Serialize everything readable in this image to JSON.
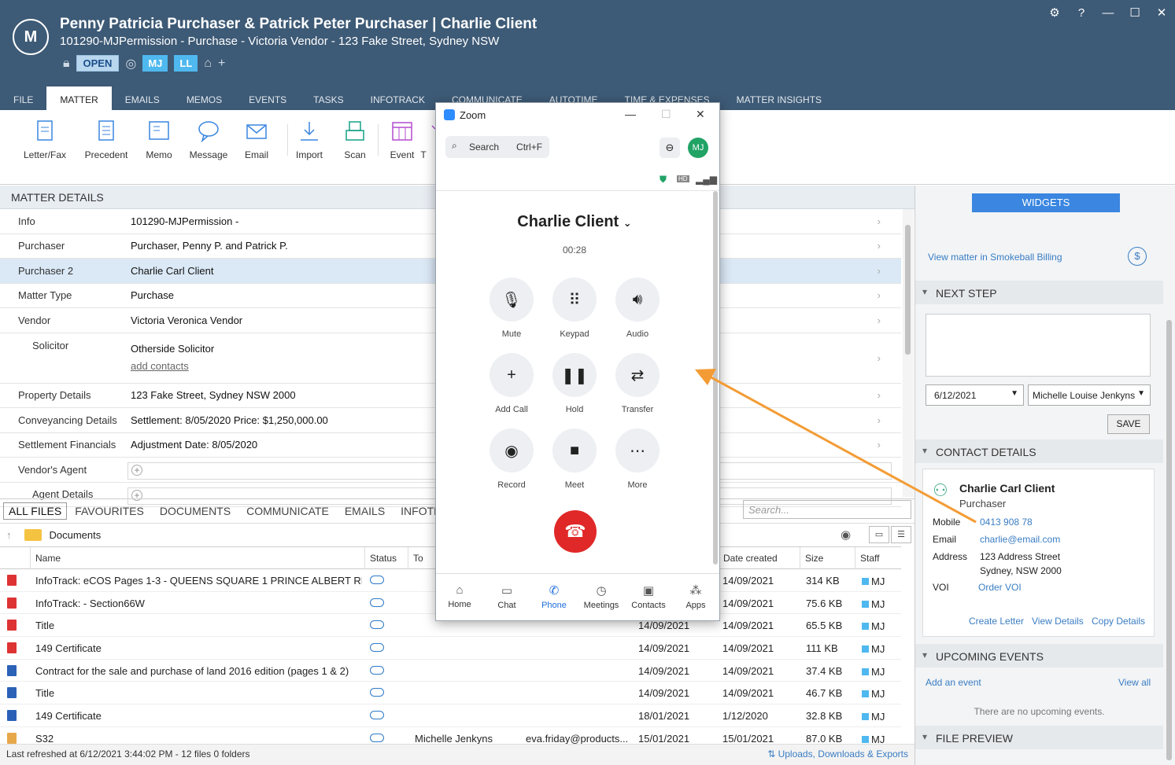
{
  "header": {
    "title": "Penny Patricia Purchaser & Patrick Peter Purchaser | Charlie Client",
    "subtitle": "101290-MJPermission  - Purchase - Victoria Vendor - 123 Fake Street, Sydney NSW",
    "status": "OPEN",
    "users": [
      "MJ",
      "LL"
    ],
    "window_controls": [
      "gear-icon",
      "help-icon",
      "minimize-icon",
      "maximize-icon",
      "close-icon"
    ]
  },
  "tabs": [
    "FILE",
    "MATTER",
    "EMAILS",
    "MEMOS",
    "EVENTS",
    "TASKS",
    "INFOTRACK",
    "COMMUNICATE",
    "AUTOTIME",
    "TIME & EXPENSES",
    "MATTER INSIGHTS"
  ],
  "ribbon": [
    "Letter/Fax",
    "Precedent",
    "Memo",
    "Message",
    "Email",
    "Import",
    "Scan",
    "Event",
    "T"
  ],
  "matter_details": {
    "header": "MATTER DETAILS",
    "rows": [
      {
        "label": "Info",
        "value": "101290-MJPermission -"
      },
      {
        "label": "Purchaser",
        "value": "Purchaser, Penny P. and Patrick P."
      },
      {
        "label": "Purchaser 2",
        "value": "Charlie Carl Client"
      },
      {
        "label": "Matter Type",
        "value": "Purchase"
      },
      {
        "label": "Vendor",
        "value": "Victoria Veronica Vendor"
      },
      {
        "label": "Solicitor",
        "value": "Otherside Solicitor",
        "link": "add contacts"
      },
      {
        "label": "Property Details",
        "value": "123 Fake Street, Sydney NSW 2000"
      },
      {
        "label": "Conveyancing Details",
        "value": "Settlement: 8/05/2020 Price: $1,250,000.00"
      },
      {
        "label": "Settlement Financials",
        "value": "Adjustment Date: 8/05/2020"
      },
      {
        "label": "Vendor's Agent",
        "value": ""
      },
      {
        "label": "Agent Details",
        "value": ""
      }
    ]
  },
  "file_tabs": [
    "ALL FILES",
    "FAVOURITES",
    "DOCUMENTS",
    "COMMUNICATE",
    "EMAILS",
    "INFOTRACK"
  ],
  "file_search_placeholder": "Search...",
  "path": "Documents",
  "columns": [
    "Name",
    "Status",
    "To",
    "",
    "Date created",
    "Size",
    "Staff"
  ],
  "files": [
    {
      "type": "pdf",
      "name": "InfoTrack: eCOS Pages 1-3 - QUEENS SQUARE 1 PRINCE ALBERT RD &...",
      "to": "",
      "from": "",
      "modified": "",
      "created": "14/09/2021",
      "size": "314 KB",
      "staff": "MJ"
    },
    {
      "type": "pdf",
      "name": "InfoTrack:  - Section66W",
      "to": "",
      "from": "",
      "modified": "",
      "created": "14/09/2021",
      "size": "75.6 KB",
      "staff": "MJ"
    },
    {
      "type": "pdf",
      "name": "Title",
      "to": "",
      "from": "",
      "modified": "14/09/2021",
      "created": "14/09/2021",
      "size": "65.5 KB",
      "staff": "MJ"
    },
    {
      "type": "pdf",
      "name": "149 Certificate",
      "to": "",
      "from": "",
      "modified": "14/09/2021",
      "created": "14/09/2021",
      "size": "111 KB",
      "staff": "MJ"
    },
    {
      "type": "doc",
      "name": "Contract for the sale and purchase of land 2016 edition (pages 1 & 2)",
      "to": "",
      "from": "",
      "modified": "14/09/2021",
      "created": "14/09/2021",
      "size": "37.4 KB",
      "staff": "MJ"
    },
    {
      "type": "doc",
      "name": "Title",
      "to": "",
      "from": "",
      "modified": "14/09/2021",
      "created": "14/09/2021",
      "size": "46.7 KB",
      "staff": "MJ"
    },
    {
      "type": "doc",
      "name": "149 Certificate",
      "to": "",
      "from": "",
      "modified": "18/01/2021",
      "created": "1/12/2020",
      "size": "32.8 KB",
      "staff": "MJ"
    },
    {
      "type": "eml",
      "name": "S32",
      "to": "Michelle Jenkyns",
      "from": "eva.friday@products...",
      "modified": "15/01/2021",
      "created": "15/01/2021",
      "size": "87.0 KB",
      "staff": "MJ"
    }
  ],
  "status_bar": {
    "text": "Last refreshed at 6/12/2021 3:44:02 PM  -  12 files  0 folders",
    "link": "Uploads, Downloads & Exports"
  },
  "widgets": {
    "button": "WIDGETS",
    "billing_link": "View matter in Smokeball Billing",
    "next_step": {
      "header": "NEXT STEP",
      "date": "6/12/2021",
      "staff": "Michelle Louise Jenkyns",
      "save": "SAVE"
    },
    "contact": {
      "header": "CONTACT DETAILS",
      "name": "Charlie Carl Client",
      "role": "Purchaser",
      "mobile_label": "Mobile",
      "mobile": "0413 908 78",
      "email_label": "Email",
      "email": "charlie@email.com",
      "address_label": "Address",
      "address1": "123 Address Street",
      "address2": "Sydney, NSW 2000",
      "voi_label": "VOI",
      "voi": "Order VOI",
      "actions": [
        "Create Letter",
        "View Details",
        "Copy Details"
      ]
    },
    "events": {
      "header": "UPCOMING EVENTS",
      "add": "Add an event",
      "view": "View all",
      "empty": "There are no upcoming events."
    },
    "preview": {
      "header": "FILE PREVIEW"
    }
  },
  "zoom": {
    "title": "Zoom",
    "search": "Search",
    "shortcut": "Ctrl+F",
    "avatar": "MJ",
    "caller": "Charlie Client",
    "timer": "00:28",
    "buttons": [
      "Mute",
      "Keypad",
      "Audio",
      "Add Call",
      "Hold",
      "Transfer",
      "Record",
      "Meet",
      "More"
    ],
    "nav": [
      "Home",
      "Chat",
      "Phone",
      "Meetings",
      "Contacts",
      "Apps"
    ],
    "active_nav": "Phone"
  },
  "colors": {
    "header_bg": "#3d5a76",
    "accent": "#3a86e0",
    "hangup": "#e02828",
    "arrow": "#f39c35"
  }
}
